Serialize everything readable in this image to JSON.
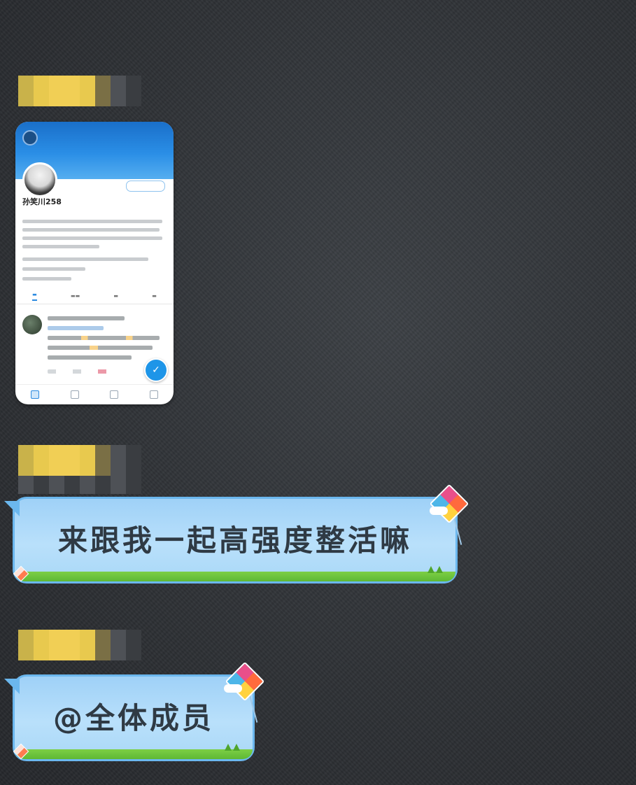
{
  "colors": {
    "background": "#2e3135",
    "bubble_fill": "#b9e0fb",
    "bubble_border": "#6bb7ee",
    "grass": "#5fb834",
    "twitter_blue": "#1e95e8"
  },
  "messages": [
    {
      "sender": "",
      "type": "image",
      "content": "screenshot"
    },
    {
      "sender": "",
      "type": "text",
      "text": "来跟我一起高强度整活嘛"
    },
    {
      "sender": "",
      "type": "text",
      "text": "@全体成员"
    }
  ],
  "screenshot": {
    "name": "孙笑川258",
    "icons": [
      "back-icon",
      "home-icon",
      "search-icon",
      "notification-icon",
      "message-icon",
      "compose-icon"
    ]
  }
}
